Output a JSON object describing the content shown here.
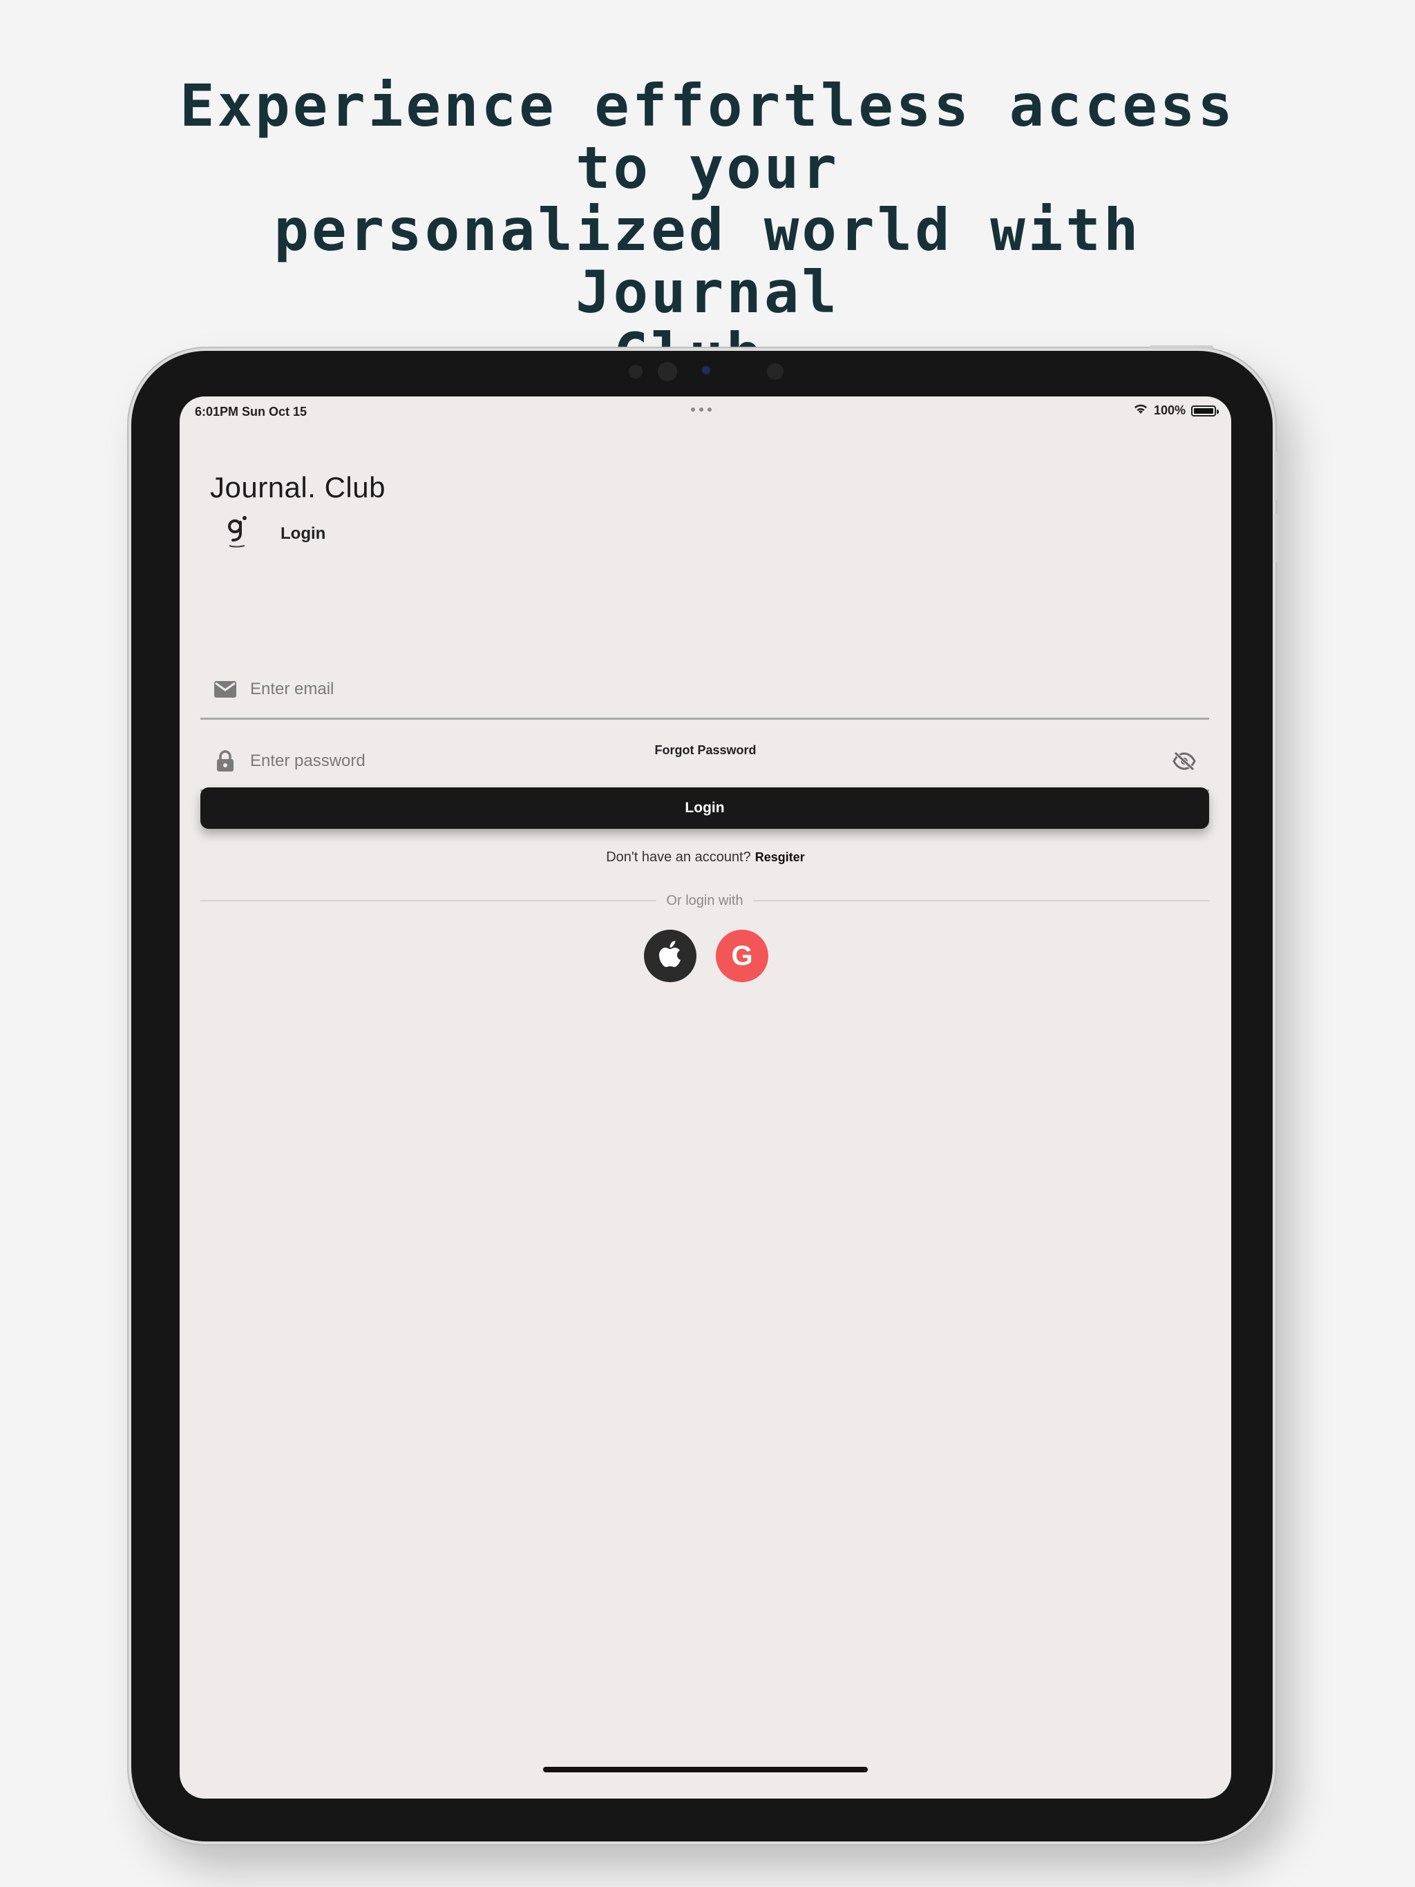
{
  "headline": {
    "line1": "Experience effortless access to your",
    "line2": "personalized world with Journal",
    "line3": "Club."
  },
  "status_bar": {
    "time_date": "6:01PM  Sun Oct 15",
    "battery": "100%",
    "icons": [
      "wifi-icon",
      "battery-icon"
    ]
  },
  "app": {
    "brand": "Journal. Club",
    "screen_title": "Login",
    "email": {
      "placeholder": "Enter email",
      "value": "",
      "icon": "mail-icon"
    },
    "password": {
      "placeholder": "Enter password",
      "value": "",
      "icon": "lock-icon",
      "toggle_icon": "eye-off-icon"
    },
    "forgot_label": "Forgot Password",
    "login_label": "Login",
    "no_account_text": "Don't have an account?",
    "register_label": "Resgiter",
    "or_login_with": "Or login with",
    "social": [
      {
        "name": "apple",
        "icon": "apple-icon",
        "color": "#2b2b2b"
      },
      {
        "name": "google",
        "icon": "google-icon",
        "glyph": "G",
        "color": "#f25656"
      }
    ]
  },
  "colors": {
    "headline": "#173139",
    "screen_bg": "#eeebea",
    "primary_button": "#181818"
  }
}
